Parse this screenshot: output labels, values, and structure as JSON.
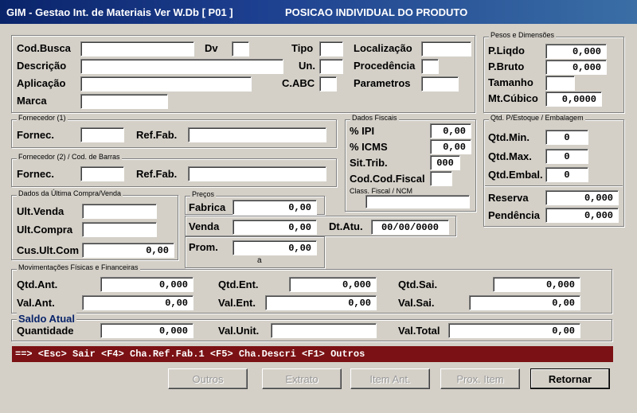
{
  "window": {
    "title": "GIM - Gestao Int. de Materiais  Ver W.Db  [ P01 ]",
    "subtitle": "POSICAO INDIVIDUAL DO PRODUTO"
  },
  "produto": {
    "cod_busca_label": "Cod.Busca",
    "cod_busca": "",
    "dv_label": "Dv",
    "dv": "",
    "tipo_label": "Tipo",
    "tipo": "",
    "localizacao_label": "Localização",
    "localizacao": "",
    "descricao_label": "Descrição",
    "descricao": "",
    "un_label": "Un.",
    "un": "",
    "procedencia_label": "Procedência",
    "procedencia": "",
    "aplicacao_label": "Aplicação",
    "aplicacao": "",
    "cabc_label": "C.ABC",
    "cabc": "",
    "parametros_label": "Parametros",
    "parametros": "",
    "marca_label": "Marca",
    "marca": ""
  },
  "pesos": {
    "group": "Pesos e Dimensões",
    "p_liqdo_label": "P.Liqdo",
    "p_liqdo": "0,000",
    "p_bruto_label": "P.Bruto",
    "p_bruto": "0,000",
    "tamanho_label": "Tamanho",
    "tamanho": "",
    "mt_cubico_label": "Mt.Cúbico",
    "mt_cubico": "0,0000"
  },
  "fornecedor1": {
    "group": "Fornecedor (1)",
    "fornec_label": "Fornec.",
    "fornec": "",
    "ref_fab_label": "Ref.Fab.",
    "ref_fab": ""
  },
  "fornecedor2": {
    "group": "Fornecedor (2) / Cod. de Barras",
    "fornec_label": "Fornec.",
    "fornec": "",
    "ref_fab_label": "Ref.Fab.",
    "ref_fab": ""
  },
  "fiscais": {
    "group": "Dados Fiscais",
    "ipi_label": "% IPI",
    "ipi": "0,00",
    "icms_label": "% ICMS",
    "icms": "0,00",
    "sit_trib_label": "Sit.Trib.",
    "sit_trib": "000",
    "cod_fiscal_label": "Cod.Cod.Fiscal",
    "cod_fiscal": "",
    "ncm_label": "Class. Fiscal / NCM",
    "ncm": ""
  },
  "estoque": {
    "group": "Qtd. P/Estoque / Embalagem",
    "qtd_min_label": "Qtd.Min.",
    "qtd_min": "0",
    "qtd_max_label": "Qtd.Max.",
    "qtd_max": "0",
    "qtd_embal_label": "Qtd.Embal.",
    "qtd_embal": "0",
    "reserva_label": "Reserva",
    "reserva": "0,000",
    "pendencia_label": "Pendência",
    "pendencia": "0,000"
  },
  "ultima": {
    "group": "Dados da Última Compra/Venda",
    "ult_venda_label": "Ult.Venda",
    "ult_venda": "",
    "ult_compra_label": "Ult.Compra",
    "ult_compra": "",
    "cus_ult_com_label": "Cus.Ult.Com",
    "cus_ult_com": "0,00"
  },
  "precos": {
    "group": "Preços",
    "fabrica_label": "Fabrica",
    "fabrica": "0,00",
    "venda_label": "Venda",
    "venda": "0,00",
    "dt_atu_label": "Dt.Atu.",
    "dt_atu": "00/00/0000",
    "prom_label": "Prom.",
    "prom": "0,00",
    "prom_note": "a"
  },
  "movimentacoes": {
    "group": "Movimentações Físicas e Financeiras",
    "qtd_ant_label": "Qtd.Ant.",
    "qtd_ant": "0,000",
    "qtd_ent_label": "Qtd.Ent.",
    "qtd_ent": "0,000",
    "qtd_sai_label": "Qtd.Sai.",
    "qtd_sai": "0,000",
    "val_ant_label": "Val.Ant.",
    "val_ant": "0,00",
    "val_ent_label": "Val.Ent.",
    "val_ent": "0,00",
    "val_sai_label": "Val.Sai.",
    "val_sai": "0,00"
  },
  "saldo": {
    "group": "Saldo Atual",
    "quantidade_label": "Quantidade",
    "quantidade": "0,000",
    "val_unit_label": "Val.Unit.",
    "val_unit": "",
    "val_total_label": "Val.Total",
    "val_total": "0,00"
  },
  "statusbar": {
    "text": "==> <Esc> Sair  <F4> Cha.Ref.Fab.1  <F5> Cha.Descri  <F1> Outros"
  },
  "buttons": {
    "outros": "Outros",
    "extrato": "Extrato",
    "item_ant": "Item Ant.",
    "prox_item": "Prox. Item",
    "retornar": "Retornar"
  }
}
